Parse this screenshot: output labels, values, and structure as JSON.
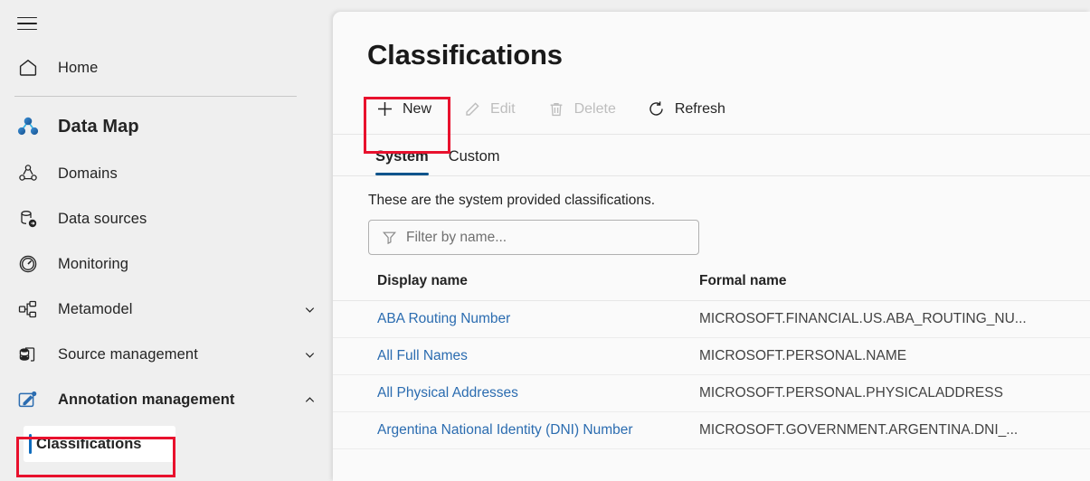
{
  "sidebar": {
    "menu_icon": "hamburger-icon",
    "items": [
      {
        "label": "Home",
        "icon": "home-icon",
        "type": "link"
      },
      {
        "label": "Data Map",
        "icon": "data-map-icon",
        "type": "section-header"
      },
      {
        "label": "Domains",
        "icon": "domains-icon",
        "type": "link"
      },
      {
        "label": "Data sources",
        "icon": "data-sources-icon",
        "type": "link"
      },
      {
        "label": "Monitoring",
        "icon": "monitoring-icon",
        "type": "link"
      },
      {
        "label": "Metamodel",
        "icon": "metamodel-icon",
        "type": "expandable",
        "chevron": "chevron-down-icon"
      },
      {
        "label": "Source management",
        "icon": "source-management-icon",
        "type": "expandable",
        "chevron": "chevron-down-icon"
      },
      {
        "label": "Annotation management",
        "icon": "annotation-management-icon",
        "type": "expandable",
        "chevron": "chevron-up-icon",
        "expanded": true
      }
    ],
    "sub_items": [
      {
        "label": "Classifications",
        "selected": true,
        "highlighted": true
      }
    ]
  },
  "main": {
    "title": "Classifications",
    "toolbar": [
      {
        "label": "New",
        "icon": "plus-icon",
        "enabled": true,
        "highlighted": true
      },
      {
        "label": "Edit",
        "icon": "pencil-icon",
        "enabled": false
      },
      {
        "label": "Delete",
        "icon": "trash-icon",
        "enabled": false
      },
      {
        "label": "Refresh",
        "icon": "refresh-icon",
        "enabled": true
      }
    ],
    "tabs": [
      {
        "label": "System",
        "active": true
      },
      {
        "label": "Custom",
        "active": false
      }
    ],
    "subtitle": "These are the system provided classifications.",
    "filter": {
      "icon": "filter-icon",
      "value": "",
      "placeholder": "Filter by name..."
    },
    "table": {
      "columns": [
        "Display name",
        "Formal name"
      ],
      "rows": [
        {
          "display_name": "ABA Routing Number",
          "formal_name": "MICROSOFT.FINANCIAL.US.ABA_ROUTING_NU..."
        },
        {
          "display_name": "All Full Names",
          "formal_name": "MICROSOFT.PERSONAL.NAME"
        },
        {
          "display_name": "All Physical Addresses",
          "formal_name": "MICROSOFT.PERSONAL.PHYSICALADDRESS"
        },
        {
          "display_name": "Argentina National Identity (DNI) Number",
          "formal_name": "MICROSOFT.GOVERNMENT.ARGENTINA.DNI_..."
        }
      ]
    }
  },
  "colors": {
    "accent_blue": "#0f6cbd",
    "tab_underline": "#0f548c",
    "link_blue": "#2b6cb0",
    "annotation_red": "#e8112d",
    "sidebar_bg": "#efefef",
    "panel_bg": "#fafafa"
  }
}
